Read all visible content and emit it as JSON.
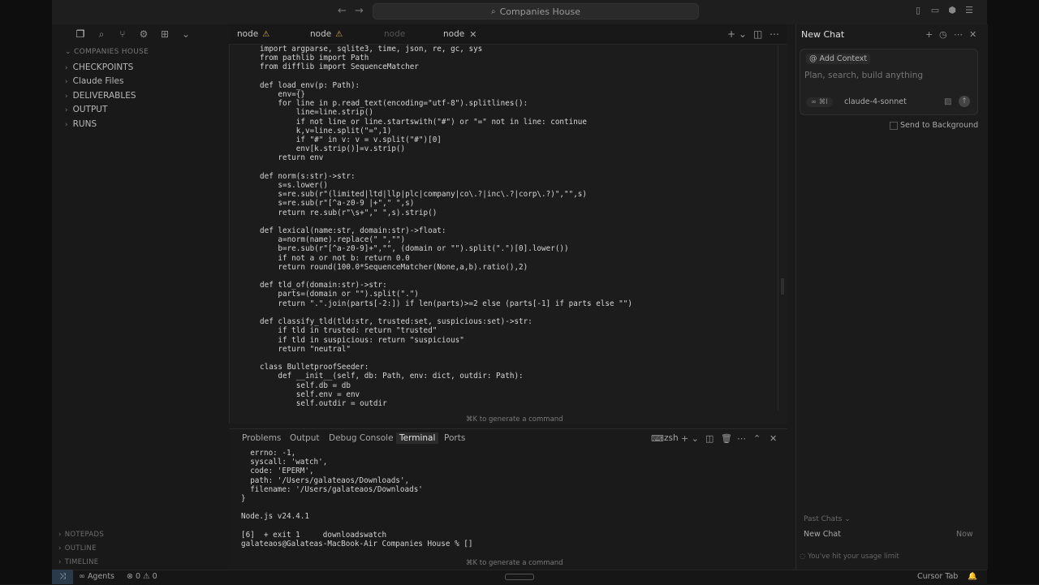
{
  "window": {
    "search_title": "Companies House"
  },
  "sidebar": {
    "section_title": "COMPANIES HOUSE",
    "items": [
      {
        "label": "CHECKPOINTS"
      },
      {
        "label": "Claude Files"
      },
      {
        "label": "DELIVERABLES"
      },
      {
        "label": "OUTPUT"
      },
      {
        "label": "RUNS"
      }
    ],
    "bottom": [
      {
        "label": "NOTEPADS"
      },
      {
        "label": "OUTLINE"
      },
      {
        "label": "TIMELINE"
      }
    ]
  },
  "editor": {
    "tabs": [
      {
        "label": "node",
        "warning": true
      },
      {
        "label": "node",
        "warning": true
      },
      {
        "label": "node",
        "dim": true
      },
      {
        "label": "node",
        "active": true
      }
    ],
    "code_lines": [
      "import argparse, sqlite3, time, json, re, gc, sys",
      "from pathlib import Path",
      "from difflib import SequenceMatcher",
      "",
      "def load_env(p: Path):",
      "    env={}",
      "    for line in p.read_text(encoding=\"utf-8\").splitlines():",
      "        line=line.strip()",
      "        if not line or line.startswith(\"#\") or \"=\" not in line: continue",
      "        k,v=line.split(\"=\",1)",
      "        if \"#\" in v: v = v.split(\"#\")[0]",
      "        env[k.strip()]=v.strip()",
      "    return env",
      "",
      "def norm(s:str)->str:",
      "    s=s.lower()",
      "    s=re.sub(r\"(limited|ltd|llp|plc|company|co\\.?|inc\\.?|corp\\.?)\",\"\",s)",
      "    s=re.sub(r\"[^a-z0-9 |+\",\" \",s)",
      "    return re.sub(r\"\\s+\",\" \",s).strip()",
      "",
      "def lexical(name:str, domain:str)->float:",
      "    a=norm(name).replace(\" \",\"\")",
      "    b=re.sub(r\"[^a-z0-9]+\",\"\", (domain or \"\").split(\".\")[0].lower())",
      "    if not a or not b: return 0.0",
      "    return round(100.0*SequenceMatcher(None,a,b).ratio(),2)",
      "",
      "def tld_of(domain:str)->str:",
      "    parts=(domain or \"\").split(\".\")",
      "    return \".\".join(parts[-2:]) if len(parts)>=2 else (parts[-1] if parts else \"\")",
      "",
      "def classify_tld(tld:str, trusted:set, suspicious:set)->str:",
      "    if tld in trusted: return \"trusted\"",
      "    if tld in suspicious: return \"suspicious\"",
      "    return \"neutral\"",
      "",
      "class BulletproofSeeder:",
      "    def __init__(self, db: Path, env: dict, outdir: Path):",
      "        self.db = db",
      "        self.env = env",
      "        self.outdir = outdir"
    ],
    "cmdk_hint": "⌘K to generate a command"
  },
  "panel": {
    "tabs": [
      "Problems",
      "Output",
      "Debug Console",
      "Terminal",
      "Ports"
    ],
    "active_tab": "Terminal",
    "shell": "zsh",
    "terminal_lines": [
      "  errno: -1,",
      "  syscall: 'watch',",
      "  code: 'EPERM',",
      "  path: '/Users/galateaos/Downloads',",
      "  filename: '/Users/galateaos/Downloads'",
      "}",
      "",
      "Node.js v24.4.1",
      "",
      "[6]  + exit 1     downloadswatch",
      "galateaos@Galateas-MacBook-Air Companies House % []"
    ],
    "cmdk_hint": "⌘K to generate a command"
  },
  "chat": {
    "title": "New Chat",
    "add_context": "@ Add Context",
    "placeholder": "Plan, search, build anything",
    "mode": "∞ ⌘I",
    "model": "claude-4-sonnet",
    "send_background": "Send to Background",
    "past_chats": "Past Chats ⌄",
    "past_items": [
      {
        "title": "New Chat",
        "time": "Now"
      }
    ],
    "usage_limit": "You've hit your usage limit"
  },
  "statusbar": {
    "agents": "Agents",
    "problems": "⊗ 0 ⚠ 0",
    "cursor_tab": "Cursor Tab"
  }
}
